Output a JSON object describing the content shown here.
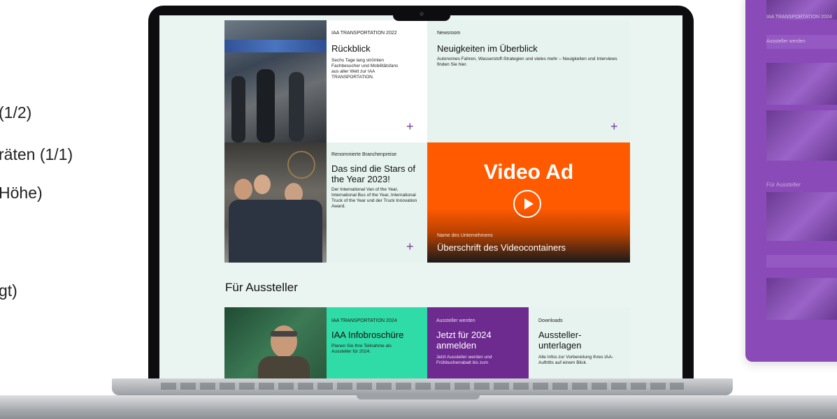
{
  "left_slide": {
    "lines": [
      "(1/2)",
      "räten (1/1)",
      "Höhe)",
      "gt)"
    ]
  },
  "website": {
    "tiles": [
      {
        "kicker": "IAA TRANSPORTATION 2022",
        "title": "Rückblick",
        "description": "Sechs Tage lang strömten Fachbesucher und Mobilitätsfans aus aller Welt zur IAA TRANSPORTATION.",
        "plus": "+"
      },
      {
        "kicker": "Newsroom",
        "title": "Neuigkeiten im Überblick",
        "description": "Autonomes Fahren, Wasserstoff-Strategien und vieles mehr – Neuigkeiten und Interviews finden Sie hier.",
        "plus": "+"
      },
      {
        "kicker": "Renommierte Branchenpreise",
        "title": "Das sind die Stars of the Year 2023!",
        "description": "Der International Van of the Year, International Bus of the Year, International Truck of the Year und der Truck Innovation Award.",
        "plus": "+"
      }
    ],
    "video": {
      "heading": "Video Ad",
      "company": "Name des Unternehmens",
      "title": "Überschrift des Videocontainers"
    },
    "section_title": "Für Aussteller",
    "exhibitor_tiles": [
      {
        "kicker": "IAA TRANSPORTATION 2024",
        "title": "IAA Infobroschüre",
        "description": "Planen Sie Ihre Teilnahme als Aussteller für 2024."
      },
      {
        "kicker": "Aussteller werden",
        "title": "Jetzt für 2024 anmelden",
        "description": "Jetzt Aussteller werden und Frühbucherrabatt bis zum"
      },
      {
        "kicker": "Downloads",
        "title": "Aussteller-unterlagen",
        "description": "Alle Infos zur Vorbereitung Ihres IAA-Auftritts auf einem Blick."
      }
    ]
  },
  "mobile_preview": {
    "labels": [
      "IAA TRANSPORTATION 2024",
      "Aussteller werden",
      "Für Aussteller"
    ]
  },
  "colors": {
    "mint": "#eaf5f2",
    "teal": "#2fdba6",
    "purple": "#6d2b90",
    "orange": "#ff5a00",
    "mobile_bg": "#8a4bb8"
  }
}
